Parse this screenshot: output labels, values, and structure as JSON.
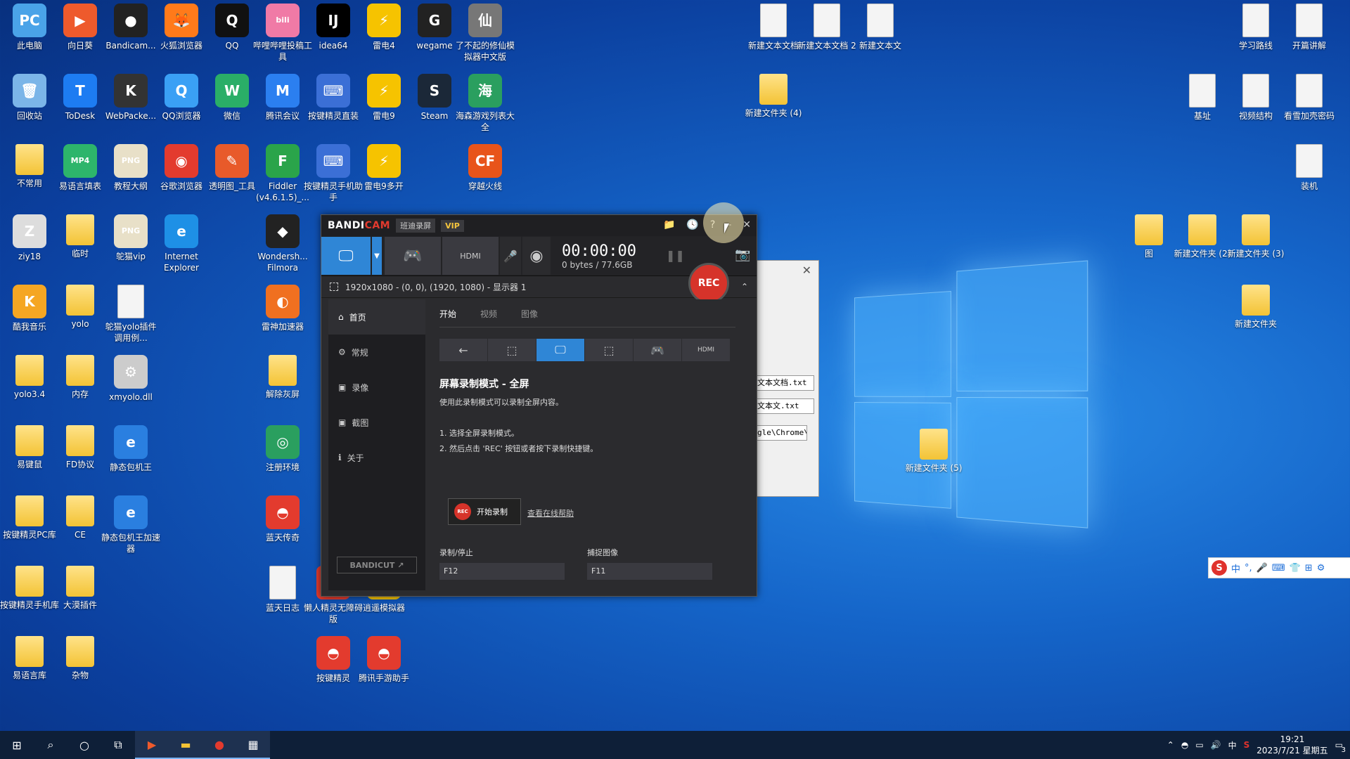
{
  "desktop_icons": [
    {
      "label": "此电脑",
      "glyph": "PC",
      "color": "#4aa3e8"
    },
    {
      "label": "向日葵",
      "glyph": "▶",
      "color": "#ee5a2c"
    },
    {
      "label": "Bandicam...",
      "glyph": "●",
      "color": "#222"
    },
    {
      "label": "火狐浏览器",
      "glyph": "🦊",
      "color": "#ff7a1a"
    },
    {
      "label": "QQ",
      "glyph": "Q",
      "color": "#111"
    },
    {
      "label": "哔哩哔哩投稿工具",
      "glyph": "bili",
      "color": "#f07aa6"
    },
    {
      "label": "idea64",
      "glyph": "IJ",
      "color": "#000"
    },
    {
      "label": "雷电4",
      "glyph": "⚡",
      "color": "#f6c300"
    },
    {
      "label": "wegame",
      "glyph": "G",
      "color": "#222"
    },
    {
      "label": "了不起的修仙模拟器中文版",
      "glyph": "仙",
      "color": "#777"
    },
    {
      "label": "回收站",
      "glyph": "🗑",
      "color": "#7bb5e8"
    },
    {
      "label": "ToDesk",
      "glyph": "T",
      "color": "#1d7cf2"
    },
    {
      "label": "WebPacke...",
      "glyph": "K",
      "color": "#333"
    },
    {
      "label": "QQ浏览器",
      "glyph": "Q",
      "color": "#3aa0f5"
    },
    {
      "label": "微信",
      "glyph": "W",
      "color": "#2aae67"
    },
    {
      "label": "腾讯会议",
      "glyph": "M",
      "color": "#2b7ff0"
    },
    {
      "label": "按键精灵直装",
      "glyph": "⌨",
      "color": "#3b6fd6"
    },
    {
      "label": "雷电9",
      "glyph": "⚡",
      "color": "#f6c300"
    },
    {
      "label": "Steam",
      "glyph": "S",
      "color": "#1b2838"
    },
    {
      "label": "海森游戏列表大全",
      "glyph": "海",
      "color": "#2a9f5f"
    },
    {
      "label": "不常用",
      "glyph": "",
      "color": "folder"
    },
    {
      "label": "易语言填表",
      "glyph": "MP4",
      "color": "#2db56b"
    },
    {
      "label": "教程大纲",
      "glyph": "PNG",
      "color": "#e8e0c8"
    },
    {
      "label": "谷歌浏览器",
      "glyph": "◉",
      "color": "#e33b2e"
    },
    {
      "label": "透明图_工具",
      "glyph": "✎",
      "color": "#e85a2a"
    },
    {
      "label": "Fiddler (v4.6.1.5)_...",
      "glyph": "F",
      "color": "#2aa44a"
    },
    {
      "label": "按键精灵手机助手",
      "glyph": "⌨",
      "color": "#3b6fd6"
    },
    {
      "label": "雷电9多开",
      "glyph": "⚡",
      "color": "#f6c300"
    },
    {
      "label": "穿越火线",
      "glyph": "CF",
      "color": "#e8541a"
    },
    {
      "label": "ziy18",
      "glyph": "Z",
      "color": "#ddd"
    },
    {
      "label": "临时",
      "glyph": "",
      "color": "folder"
    },
    {
      "label": "鸵猫vip",
      "glyph": "PNG",
      "color": "#e8e0c8"
    },
    {
      "label": "Internet Explorer",
      "glyph": "e",
      "color": "#1e90e6"
    },
    {
      "label": "Wondersh... Filmora",
      "glyph": "◆",
      "color": "#222"
    },
    {
      "label": "酷我音乐",
      "glyph": "K",
      "color": "#f5a623"
    },
    {
      "label": "yolo",
      "glyph": "",
      "color": "folder"
    },
    {
      "label": "鸵猫yolo插件调用例...",
      "glyph": "",
      "color": "doc"
    },
    {
      "label": "雷神加速器",
      "glyph": "◐",
      "color": "#f07020"
    },
    {
      "label": "yolo3.4",
      "glyph": "",
      "color": "folder"
    },
    {
      "label": "内存",
      "glyph": "",
      "color": "folder"
    },
    {
      "label": "xmyolo.dll",
      "glyph": "⚙",
      "color": "#ccc"
    },
    {
      "label": "解除灰屏",
      "glyph": "",
      "color": "folder"
    },
    {
      "label": "易键鼠",
      "glyph": "",
      "color": "folder"
    },
    {
      "label": "FD协议",
      "glyph": "",
      "color": "folder"
    },
    {
      "label": "静态包机王",
      "glyph": "e",
      "color": "#2a7fe0"
    },
    {
      "label": "注册环境",
      "glyph": "◎",
      "color": "#2a9f5f"
    },
    {
      "label": "按键精灵PC库",
      "glyph": "",
      "color": "folder"
    },
    {
      "label": "CE",
      "glyph": "",
      "color": "folder"
    },
    {
      "label": "静态包机王加速器",
      "glyph": "e",
      "color": "#2a7fe0"
    },
    {
      "label": "蓝天传奇",
      "glyph": "◓",
      "color": "#e33b2e"
    },
    {
      "label": "按键精灵手机库",
      "glyph": "",
      "color": "folder"
    },
    {
      "label": "大漠插件",
      "glyph": "",
      "color": "folder"
    },
    {
      "label": "蓝天日志",
      "glyph": "",
      "color": "doc"
    },
    {
      "label": "懒人精灵无障碍版",
      "glyph": "◓",
      "color": "#e33b2e"
    },
    {
      "label": "逍遥模拟器",
      "glyph": "◓",
      "color": "#f6c300"
    },
    {
      "label": "易语言库",
      "glyph": "",
      "color": "folder"
    },
    {
      "label": "杂物",
      "glyph": "",
      "color": "folder"
    },
    {
      "label": "按键精灵",
      "glyph": "◓",
      "color": "#e33b2e"
    },
    {
      "label": "腾讯手游助手",
      "glyph": "◓",
      "color": "#e33b2e"
    },
    {
      "label": "新建文本文档",
      "glyph": "",
      "color": "doc"
    },
    {
      "label": "新建文本文档 2",
      "glyph": "",
      "color": "doc"
    },
    {
      "label": "新建文本文",
      "glyph": "",
      "color": "doc"
    },
    {
      "label": "新建文件夹 (4)",
      "glyph": "",
      "color": "folder"
    },
    {
      "label": "学习路线",
      "glyph": "",
      "color": "doc"
    },
    {
      "label": "开篇讲解",
      "glyph": "",
      "color": "doc"
    },
    {
      "label": "基址",
      "glyph": "",
      "color": "doc"
    },
    {
      "label": "视频结构",
      "glyph": "",
      "color": "doc"
    },
    {
      "label": "看雪加壳密码",
      "glyph": "",
      "color": "doc"
    },
    {
      "label": "装机",
      "glyph": "",
      "color": "doc"
    },
    {
      "label": "图",
      "glyph": "",
      "color": "folder"
    },
    {
      "label": "新建文件夹 (2)",
      "glyph": "",
      "color": "folder"
    },
    {
      "label": "新建文件夹 (3)",
      "glyph": "",
      "color": "folder"
    },
    {
      "label": "新建文件夹",
      "glyph": "",
      "color": "folder"
    },
    {
      "label": "新建文件夹 (5)",
      "glyph": "",
      "color": "folder"
    }
  ],
  "bg_window": {
    "fields": [
      "文本文档.txt",
      "文本文.txt",
      "gle\\Chrome\\"
    ]
  },
  "bandicam": {
    "brand_a": "BANDI",
    "brand_b": "CAM",
    "subtitle": "班迪录屏",
    "vip": "VIP",
    "title_buttons": [
      "📁",
      "🕓",
      "?",
      "–",
      "✕"
    ],
    "timer": "00:00:00",
    "size": "0 bytes / 77.6GB",
    "rec": "REC",
    "region": "1920x1080 - (0, 0), (1920, 1080) - 显示器 1",
    "sidebar": [
      {
        "icon": "home-icon",
        "glyph": "⌂",
        "label": "首页"
      },
      {
        "icon": "gear-icon",
        "glyph": "⚙",
        "label": "常规"
      },
      {
        "icon": "video-icon",
        "glyph": "▣",
        "label": "录像"
      },
      {
        "icon": "image-icon",
        "glyph": "▣",
        "label": "截图"
      },
      {
        "icon": "info-icon",
        "glyph": "ℹ",
        "label": "关于"
      }
    ],
    "bandicut": "BANDICUT ↗",
    "tabs": [
      {
        "label": "开始"
      },
      {
        "label": "视频"
      },
      {
        "label": "图像"
      }
    ],
    "heading": "屏幕录制模式 - 全屏",
    "desc": "使用此录制模式可以录制全屏内容。",
    "step1": "1. 选择全屏录制模式。",
    "step2": "2. 然后点击 'REC' 按钮或者按下录制快捷键。",
    "start_btn": "开始录制",
    "start_dot": "REC",
    "help_link": "查看在线帮助",
    "hk_rec_label": "录制/停止",
    "hk_rec_val": "F12",
    "hk_cap_label": "捕捉图像",
    "hk_cap_val": "F11"
  },
  "ime": {
    "chars": [
      "中",
      "°,",
      "🎤",
      "⌨",
      "👕",
      "⊞",
      "⚙"
    ]
  },
  "taskbar": {
    "time": "19:21",
    "date": "2023/7/21 星期五",
    "lang": "中",
    "notify": "3"
  }
}
